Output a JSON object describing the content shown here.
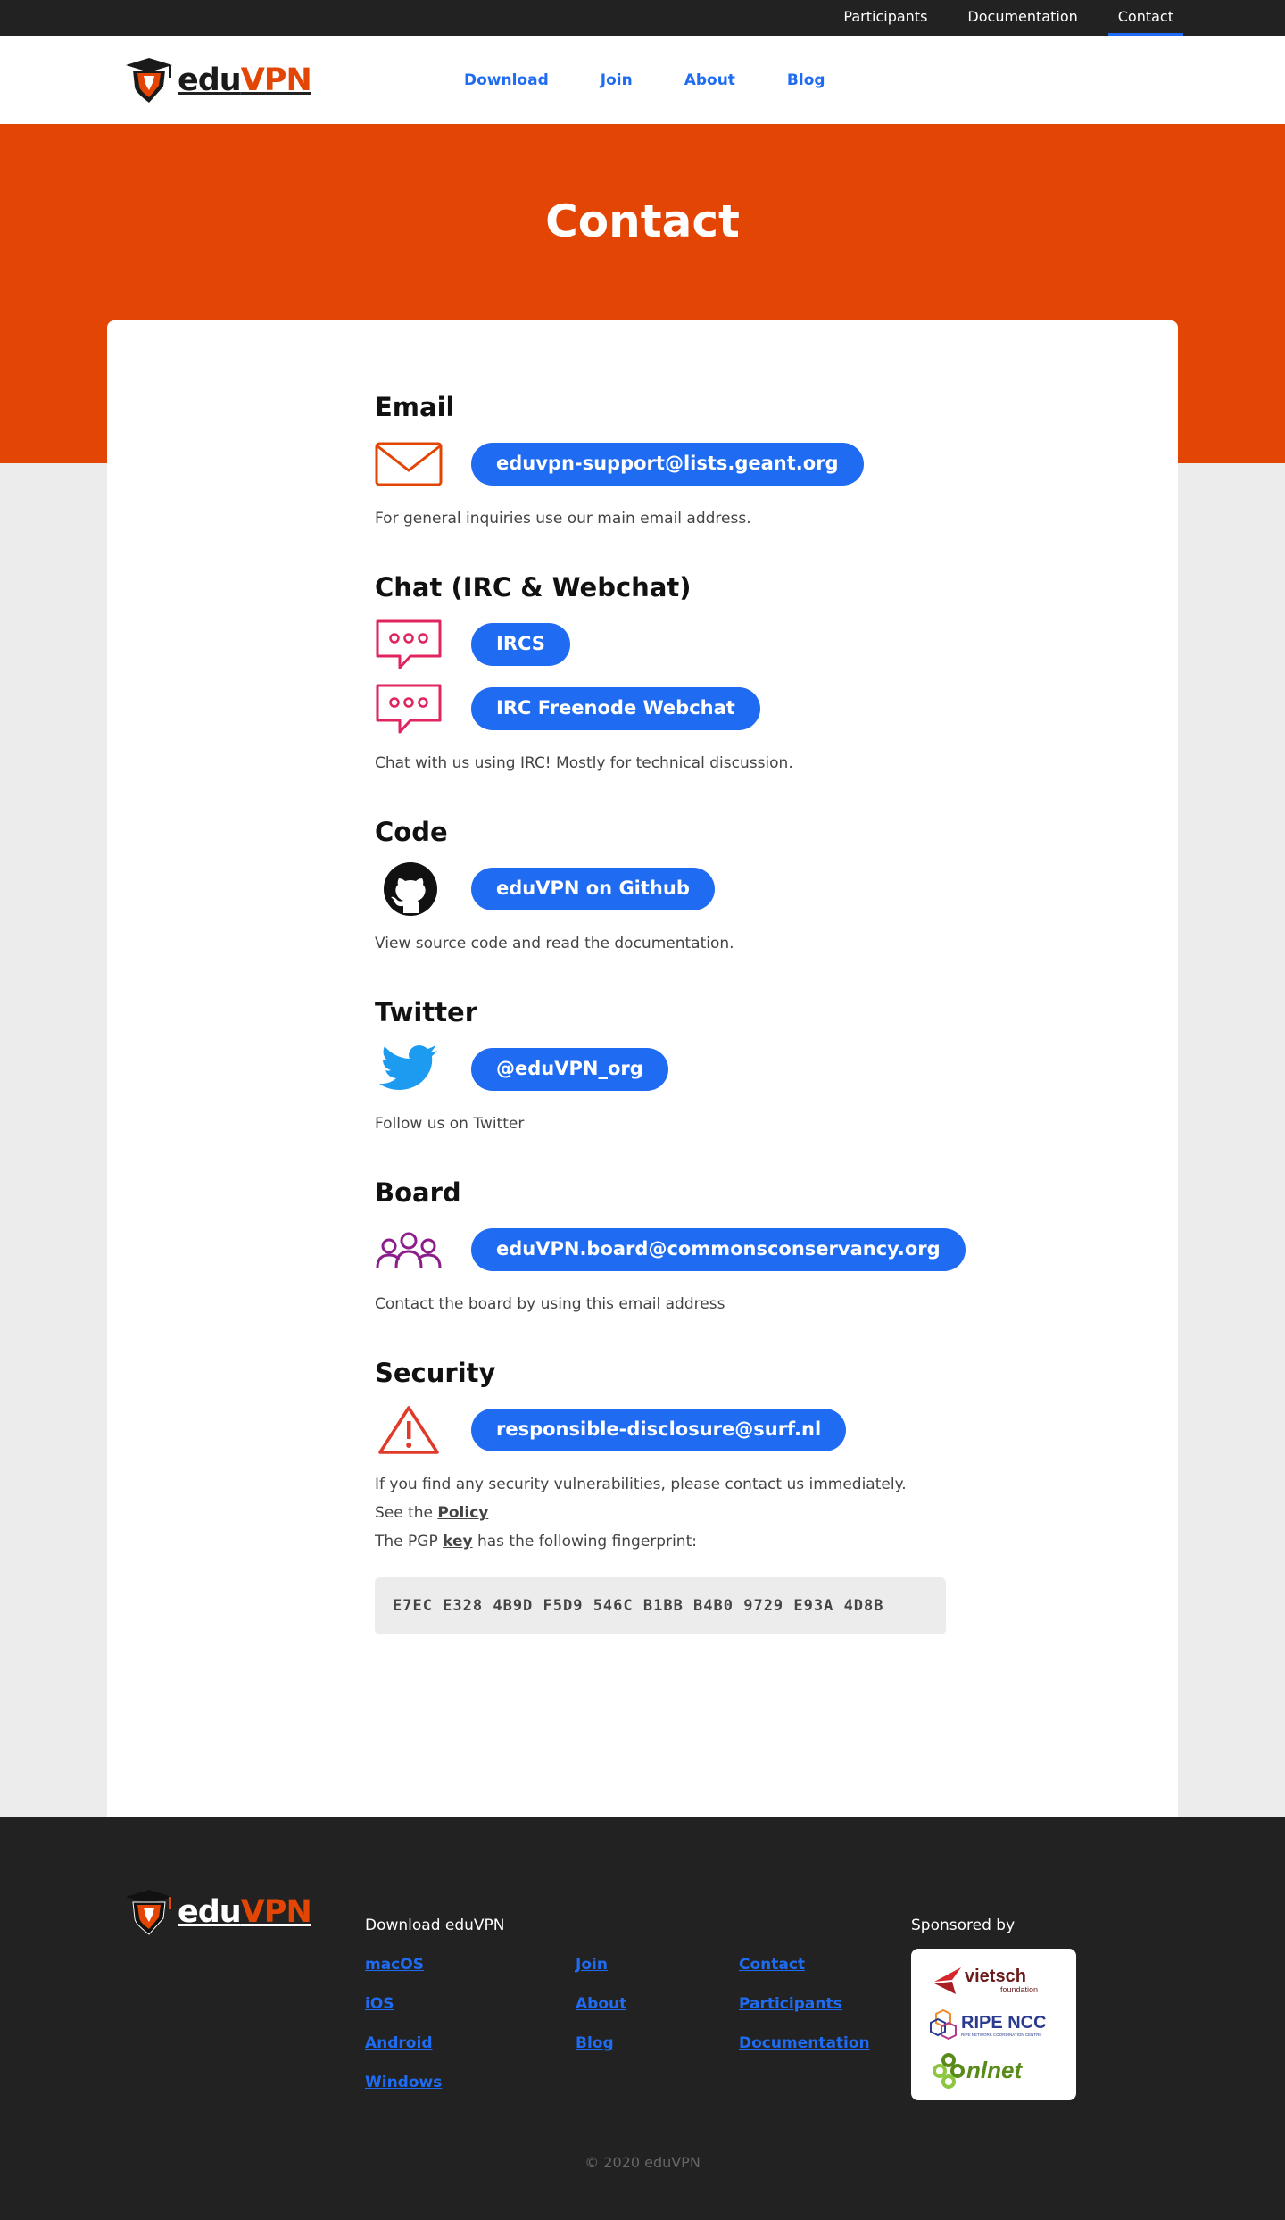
{
  "topbar": {
    "items": [
      {
        "label": "Participants",
        "active": false
      },
      {
        "label": "Documentation",
        "active": false
      },
      {
        "label": "Contact",
        "active": true
      }
    ]
  },
  "header": {
    "logo_edu": "edu",
    "logo_vpn": "VPN",
    "nav": [
      "Download",
      "Join",
      "About",
      "Blog"
    ]
  },
  "page": {
    "title": "Contact"
  },
  "sections": {
    "email": {
      "heading": "Email",
      "icon": "envelope-icon",
      "button": "eduvpn-support@lists.geant.org",
      "desc": "For general inquiries use our main email address."
    },
    "chat": {
      "heading": "Chat (IRC & Webchat)",
      "icon": "chat-bubble-icon",
      "button1": "IRCS",
      "button2": "IRC Freenode Webchat",
      "desc": "Chat with us using IRC! Mostly for technical discussion."
    },
    "code": {
      "heading": "Code",
      "icon": "github-icon",
      "button": "eduVPN on Github",
      "desc": "View source code and read the documentation."
    },
    "twitter": {
      "heading": "Twitter",
      "icon": "twitter-bird-icon",
      "button": "@eduVPN_org",
      "desc": "Follow us on Twitter"
    },
    "board": {
      "heading": "Board",
      "icon": "people-group-icon",
      "button": "eduVPN.board@commonsconservancy.org",
      "desc": "Contact the board by using this email address"
    },
    "security": {
      "heading": "Security",
      "icon": "warning-triangle-icon",
      "button": "responsible-disclosure@surf.nl",
      "desc1": "If you find any security vulnerabilities, please contact us immediately.",
      "desc2_pre": "See the ",
      "desc2_link": "Policy",
      "desc3_pre": "The PGP ",
      "desc3_link": "key",
      "desc3_post": " has the following fingerprint:",
      "fingerprint": "E7EC E328 4B9D F5D9 546C B1BB B4B0 9729 E93A 4D8B"
    }
  },
  "footer": {
    "download_heading": "Download eduVPN",
    "col1": [
      "macOS",
      "iOS",
      "Android",
      "Windows"
    ],
    "col2": [
      "Join",
      "About",
      "Blog"
    ],
    "col3": [
      "Contact",
      "Participants",
      "Documentation"
    ],
    "sponsored_by": "Sponsored by",
    "sponsors": [
      "vietsch",
      "foundation",
      "RIPE NCC",
      "RIPE NETWORK COORDINATION CENTRE",
      "nlnet"
    ],
    "copyright": "© 2020 eduVPN"
  },
  "colors": {
    "brand_orange": "#e34504",
    "link_blue": "#1f6cf2",
    "dark": "#222222"
  }
}
